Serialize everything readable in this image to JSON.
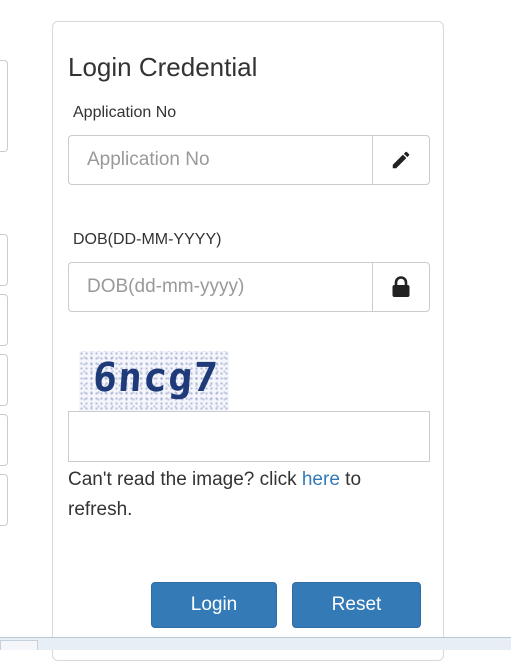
{
  "form": {
    "title": "Login Credential",
    "application_no": {
      "label": "Application No",
      "placeholder": "Application No",
      "value": "",
      "icon": "pencil-icon"
    },
    "dob": {
      "label": "DOB(DD-MM-YYYY)",
      "placeholder": "DOB(dd-mm-yyyy)",
      "value": "",
      "icon": "lock-icon"
    },
    "captcha": {
      "image_text": "6ncg7",
      "input_value": ""
    },
    "refresh": {
      "prefix": "Can't read the image? click ",
      "link": "here",
      "suffix": " to refresh."
    },
    "buttons": {
      "login": "Login",
      "reset": "Reset"
    }
  },
  "colors": {
    "primary": "#337ab7",
    "link": "#337ab7",
    "border": "#cccccc",
    "text": "#333333",
    "placeholder": "#999999"
  }
}
